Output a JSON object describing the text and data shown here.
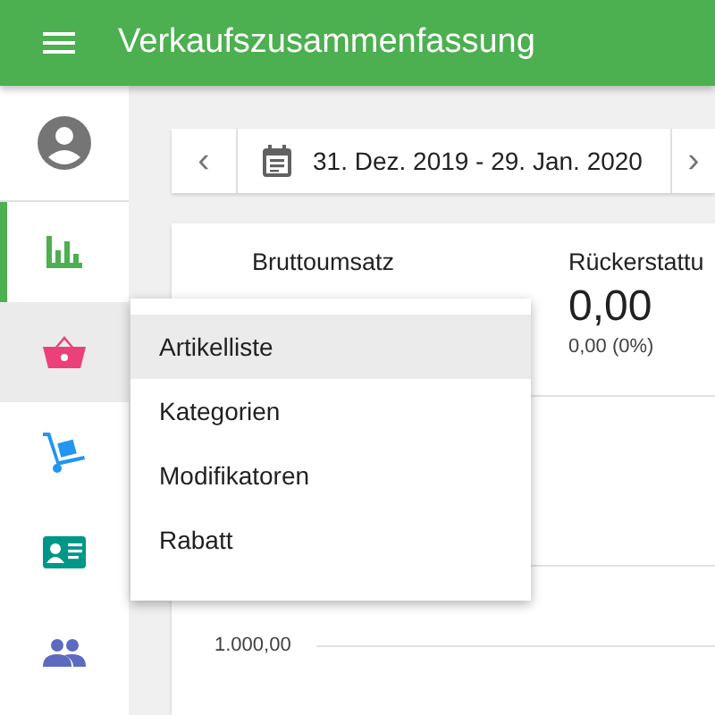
{
  "app_bar": {
    "title": "Verkaufszusammenfassung"
  },
  "sidebar": {
    "items": [
      {
        "kind": "chart",
        "color": "#4caf50",
        "selected": true,
        "expanded": false
      },
      {
        "kind": "basket",
        "color": "#ec407a",
        "selected": false,
        "expanded": true
      },
      {
        "kind": "trolley",
        "color": "#2196f3",
        "selected": false,
        "expanded": false
      },
      {
        "kind": "card",
        "color": "#009688",
        "selected": false,
        "expanded": false
      },
      {
        "kind": "people",
        "color": "#5c6bc0",
        "selected": false,
        "expanded": false
      }
    ]
  },
  "date_range": {
    "prev": "‹",
    "label": "31. Dez. 2019 - 29. Jan. 2020",
    "next": "›"
  },
  "summary": {
    "metrics": [
      {
        "label": "Bruttoumsatz"
      },
      {
        "label": "Rückerstattu",
        "value": "0,00",
        "change": "0,00 (0%)"
      }
    ]
  },
  "chart": {
    "y_tick": "1.000,00"
  },
  "menu": {
    "items": [
      {
        "label": "Artikelliste",
        "selected": true
      },
      {
        "label": "Kategorien",
        "selected": false
      },
      {
        "label": "Modifikatoren",
        "selected": false
      },
      {
        "label": "Rabatt",
        "selected": false
      }
    ]
  }
}
